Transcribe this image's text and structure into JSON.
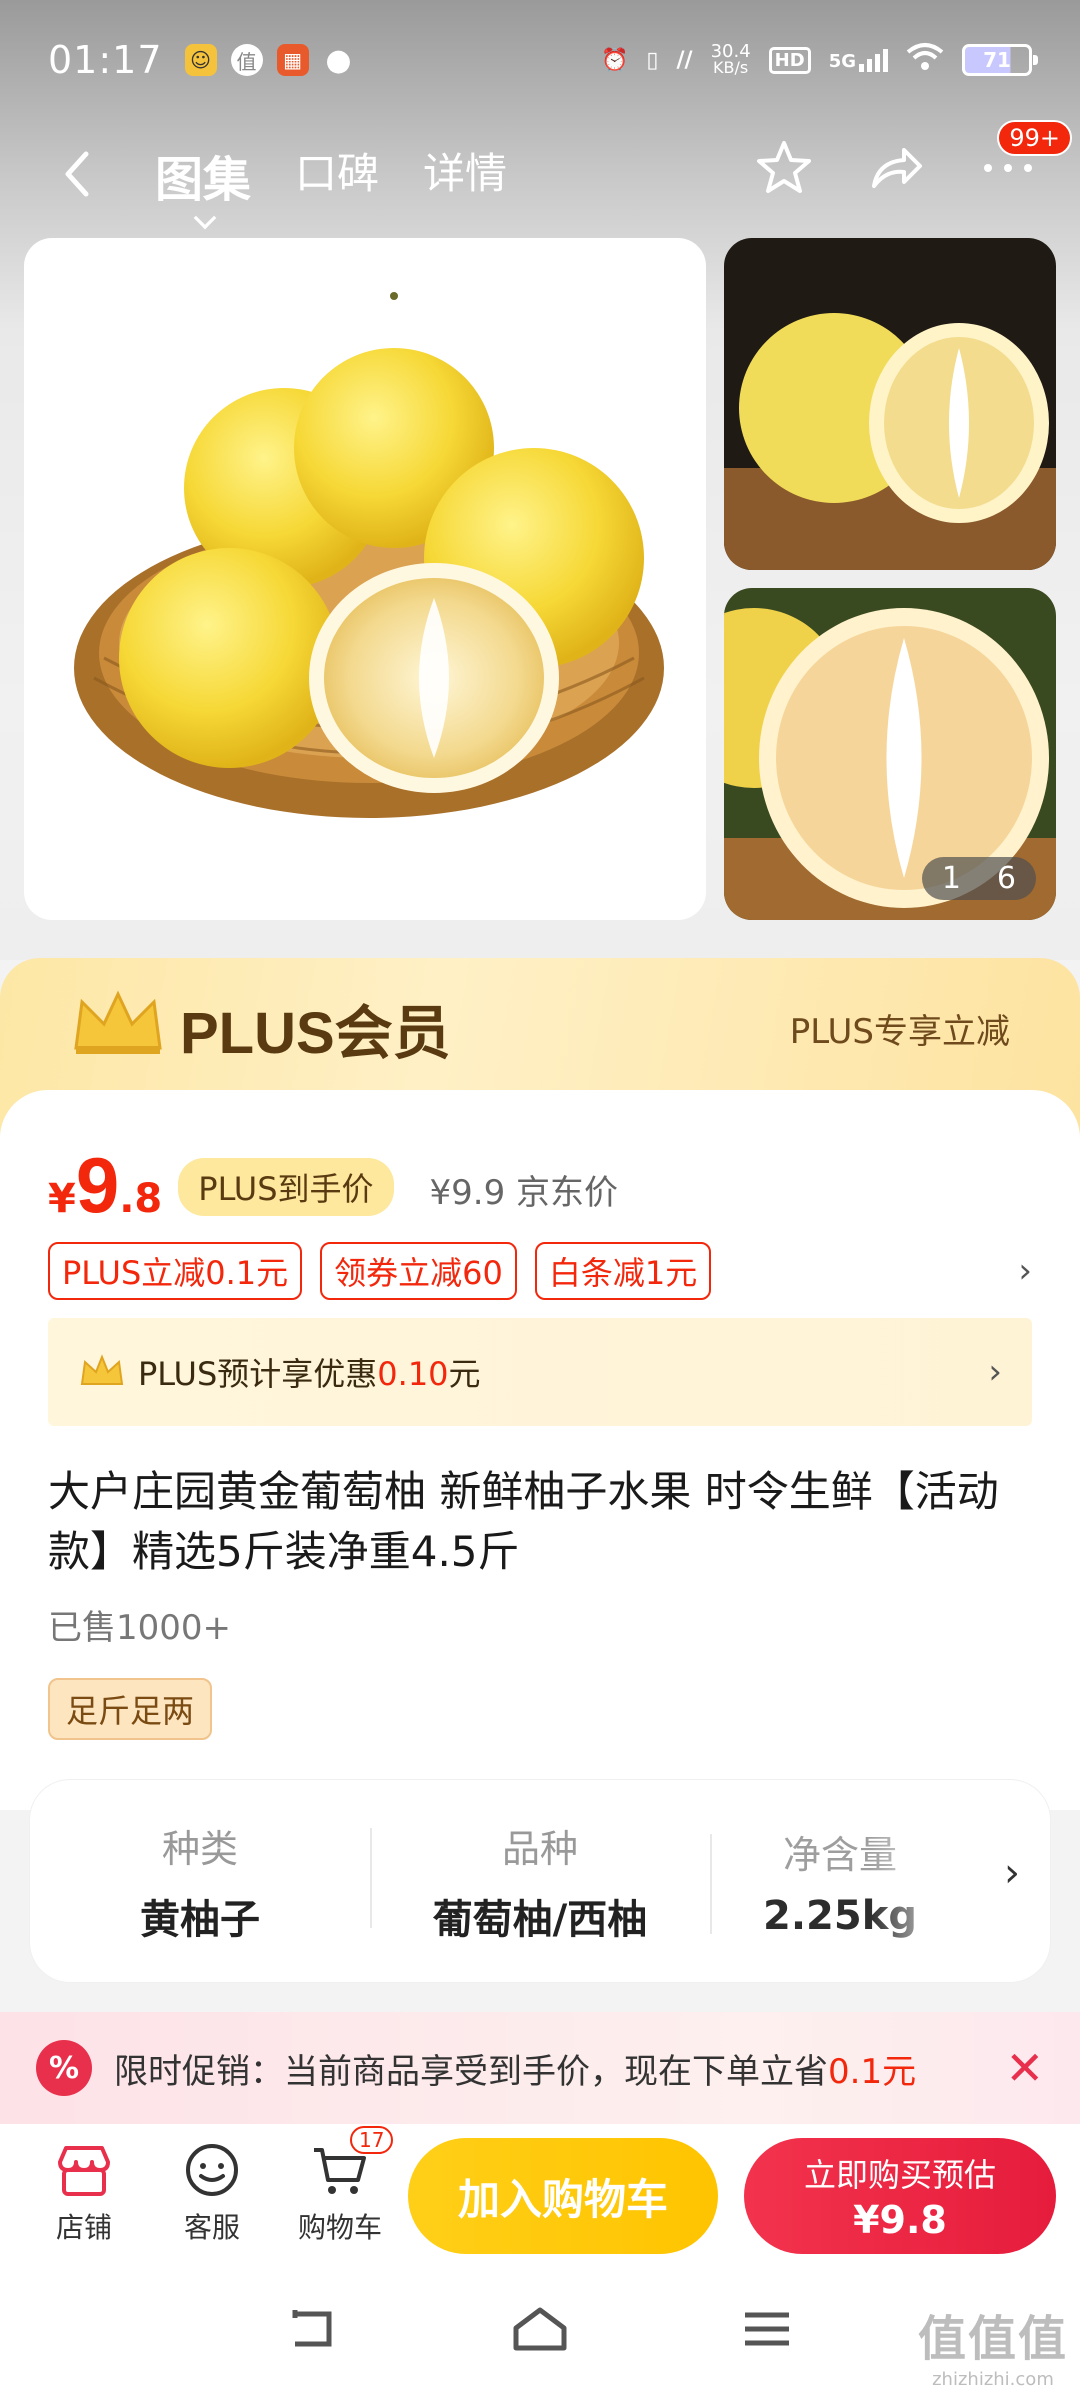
{
  "status_bar": {
    "time": "01:17",
    "net_speed_value": "30.4",
    "net_speed_unit": "KB/s",
    "hd": "HD",
    "signal": "5G",
    "battery": "71"
  },
  "nav": {
    "tabs": [
      {
        "label": "图集",
        "active": true
      },
      {
        "label": "口碑",
        "active": false
      },
      {
        "label": "详情",
        "active": false
      }
    ],
    "more_badge": "99+"
  },
  "gallery": {
    "current": "1",
    "total": "6"
  },
  "plus_banner": {
    "title": "PLUS会员",
    "tag": "PLUS专享立减"
  },
  "price": {
    "yen": "¥",
    "integer": "9",
    "decimal": ".8",
    "plus_tag": "PLUS到手价",
    "jd_price": "¥9.9 京东价"
  },
  "promos": [
    "PLUS立减0.1元",
    "领券立减60",
    "白条减1元"
  ],
  "plus_saving": {
    "prefix": "PLUS预计享优惠",
    "amount": "0.10",
    "suffix": "元"
  },
  "product": {
    "title": "大户庄园黄金葡萄柚 新鲜柚子水果 时令生鲜【活动款】精选5斤装净重4.5斤",
    "sold": "已售1000+",
    "tag": "足斤足两"
  },
  "specs": [
    {
      "label": "种类",
      "value": "黄柚子"
    },
    {
      "label": "品种",
      "value": "葡萄柚/西柚"
    },
    {
      "label": "净含量",
      "value": "2.25kg"
    }
  ],
  "promo_strip": {
    "icon": "%",
    "text": "限时促销：当前商品享受到手价，现在下单立省",
    "amount": "0.1元"
  },
  "bottom_bar": {
    "store_label": "店铺",
    "service_label": "客服",
    "cart_label": "购物车",
    "cart_count": "17",
    "add_cart_label": "加入购物车",
    "buy_line1": "立即购买预估",
    "buy_line2": "¥9.8"
  },
  "watermark": {
    "line1": "值值值",
    "line2": "zhizhizhi.com"
  },
  "colors": {
    "accent_red": "#f2270c",
    "cart_yellow": "#ffc400",
    "plus_gold": "#fde89e"
  }
}
